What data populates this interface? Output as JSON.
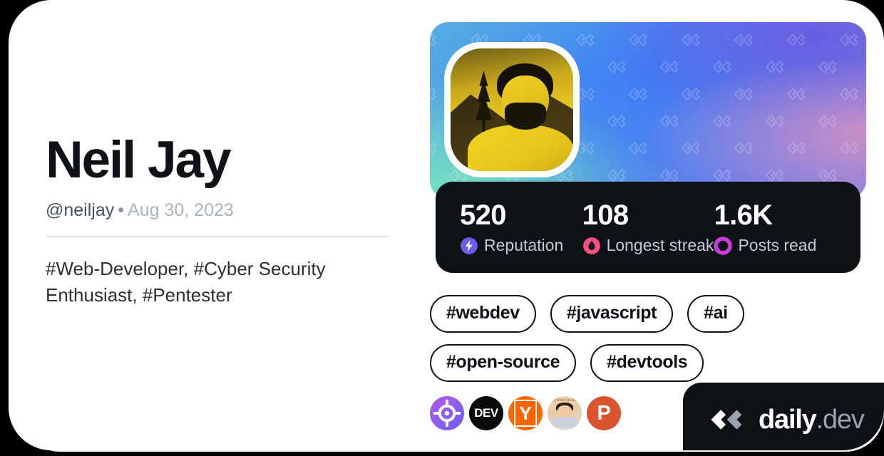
{
  "profile": {
    "name": "Neil Jay",
    "handle": "@neiljay",
    "separator": "•",
    "joined_date": "Aug 30, 2023",
    "bio": "#Web-Developer, #Cyber Security Enthusiast, #Pentester",
    "avatar_alt": "neiljay-avatar"
  },
  "stats": [
    {
      "value": "520",
      "label": "Reputation",
      "icon": "reputation-bolt-icon",
      "color": "#6d5ce7"
    },
    {
      "value": "108",
      "label": "Longest streak",
      "icon": "streak-flame-icon",
      "color": "#f8507f"
    },
    {
      "value": "1.6K",
      "label": "Posts read",
      "icon": "posts-read-ring-icon",
      "color": "#cb3bd8"
    }
  ],
  "tags": [
    {
      "label": "#webdev"
    },
    {
      "label": "#javascript"
    },
    {
      "label": "#ai"
    },
    {
      "label": "#open-source"
    },
    {
      "label": "#devtools"
    }
  ],
  "sources": [
    {
      "name": "daily-dev-source-icon",
      "text": ""
    },
    {
      "name": "devto-source-icon",
      "text": "DEV"
    },
    {
      "name": "hackernews-source-icon",
      "text": "Y"
    },
    {
      "name": "avatar-source-icon",
      "text": "@devsquad"
    },
    {
      "name": "producthunt-source-icon",
      "text": "P"
    }
  ],
  "branding": {
    "word_primary": "daily",
    "word_secondary": ".dev",
    "logo": "daily-dev-logo-mark"
  },
  "theme": {
    "card_bg": "#ffffff",
    "page_bg": "#000000",
    "ink": "#0e1217",
    "muted": "#a8b3c0"
  }
}
